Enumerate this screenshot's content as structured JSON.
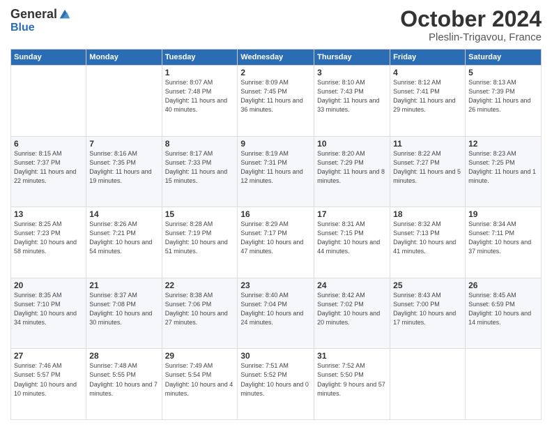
{
  "logo": {
    "general": "General",
    "blue": "Blue"
  },
  "title": "October 2024",
  "subtitle": "Pleslin-Trigavou, France",
  "headers": [
    "Sunday",
    "Monday",
    "Tuesday",
    "Wednesday",
    "Thursday",
    "Friday",
    "Saturday"
  ],
  "weeks": [
    [
      {
        "day": "",
        "info": ""
      },
      {
        "day": "",
        "info": ""
      },
      {
        "day": "1",
        "info": "Sunrise: 8:07 AM\nSunset: 7:48 PM\nDaylight: 11 hours and 40 minutes."
      },
      {
        "day": "2",
        "info": "Sunrise: 8:09 AM\nSunset: 7:45 PM\nDaylight: 11 hours and 36 minutes."
      },
      {
        "day": "3",
        "info": "Sunrise: 8:10 AM\nSunset: 7:43 PM\nDaylight: 11 hours and 33 minutes."
      },
      {
        "day": "4",
        "info": "Sunrise: 8:12 AM\nSunset: 7:41 PM\nDaylight: 11 hours and 29 minutes."
      },
      {
        "day": "5",
        "info": "Sunrise: 8:13 AM\nSunset: 7:39 PM\nDaylight: 11 hours and 26 minutes."
      }
    ],
    [
      {
        "day": "6",
        "info": "Sunrise: 8:15 AM\nSunset: 7:37 PM\nDaylight: 11 hours and 22 minutes."
      },
      {
        "day": "7",
        "info": "Sunrise: 8:16 AM\nSunset: 7:35 PM\nDaylight: 11 hours and 19 minutes."
      },
      {
        "day": "8",
        "info": "Sunrise: 8:17 AM\nSunset: 7:33 PM\nDaylight: 11 hours and 15 minutes."
      },
      {
        "day": "9",
        "info": "Sunrise: 8:19 AM\nSunset: 7:31 PM\nDaylight: 11 hours and 12 minutes."
      },
      {
        "day": "10",
        "info": "Sunrise: 8:20 AM\nSunset: 7:29 PM\nDaylight: 11 hours and 8 minutes."
      },
      {
        "day": "11",
        "info": "Sunrise: 8:22 AM\nSunset: 7:27 PM\nDaylight: 11 hours and 5 minutes."
      },
      {
        "day": "12",
        "info": "Sunrise: 8:23 AM\nSunset: 7:25 PM\nDaylight: 11 hours and 1 minute."
      }
    ],
    [
      {
        "day": "13",
        "info": "Sunrise: 8:25 AM\nSunset: 7:23 PM\nDaylight: 10 hours and 58 minutes."
      },
      {
        "day": "14",
        "info": "Sunrise: 8:26 AM\nSunset: 7:21 PM\nDaylight: 10 hours and 54 minutes."
      },
      {
        "day": "15",
        "info": "Sunrise: 8:28 AM\nSunset: 7:19 PM\nDaylight: 10 hours and 51 minutes."
      },
      {
        "day": "16",
        "info": "Sunrise: 8:29 AM\nSunset: 7:17 PM\nDaylight: 10 hours and 47 minutes."
      },
      {
        "day": "17",
        "info": "Sunrise: 8:31 AM\nSunset: 7:15 PM\nDaylight: 10 hours and 44 minutes."
      },
      {
        "day": "18",
        "info": "Sunrise: 8:32 AM\nSunset: 7:13 PM\nDaylight: 10 hours and 41 minutes."
      },
      {
        "day": "19",
        "info": "Sunrise: 8:34 AM\nSunset: 7:11 PM\nDaylight: 10 hours and 37 minutes."
      }
    ],
    [
      {
        "day": "20",
        "info": "Sunrise: 8:35 AM\nSunset: 7:10 PM\nDaylight: 10 hours and 34 minutes."
      },
      {
        "day": "21",
        "info": "Sunrise: 8:37 AM\nSunset: 7:08 PM\nDaylight: 10 hours and 30 minutes."
      },
      {
        "day": "22",
        "info": "Sunrise: 8:38 AM\nSunset: 7:06 PM\nDaylight: 10 hours and 27 minutes."
      },
      {
        "day": "23",
        "info": "Sunrise: 8:40 AM\nSunset: 7:04 PM\nDaylight: 10 hours and 24 minutes."
      },
      {
        "day": "24",
        "info": "Sunrise: 8:42 AM\nSunset: 7:02 PM\nDaylight: 10 hours and 20 minutes."
      },
      {
        "day": "25",
        "info": "Sunrise: 8:43 AM\nSunset: 7:00 PM\nDaylight: 10 hours and 17 minutes."
      },
      {
        "day": "26",
        "info": "Sunrise: 8:45 AM\nSunset: 6:59 PM\nDaylight: 10 hours and 14 minutes."
      }
    ],
    [
      {
        "day": "27",
        "info": "Sunrise: 7:46 AM\nSunset: 5:57 PM\nDaylight: 10 hours and 10 minutes."
      },
      {
        "day": "28",
        "info": "Sunrise: 7:48 AM\nSunset: 5:55 PM\nDaylight: 10 hours and 7 minutes."
      },
      {
        "day": "29",
        "info": "Sunrise: 7:49 AM\nSunset: 5:54 PM\nDaylight: 10 hours and 4 minutes."
      },
      {
        "day": "30",
        "info": "Sunrise: 7:51 AM\nSunset: 5:52 PM\nDaylight: 10 hours and 0 minutes."
      },
      {
        "day": "31",
        "info": "Sunrise: 7:52 AM\nSunset: 5:50 PM\nDaylight: 9 hours and 57 minutes."
      },
      {
        "day": "",
        "info": ""
      },
      {
        "day": "",
        "info": ""
      }
    ]
  ]
}
